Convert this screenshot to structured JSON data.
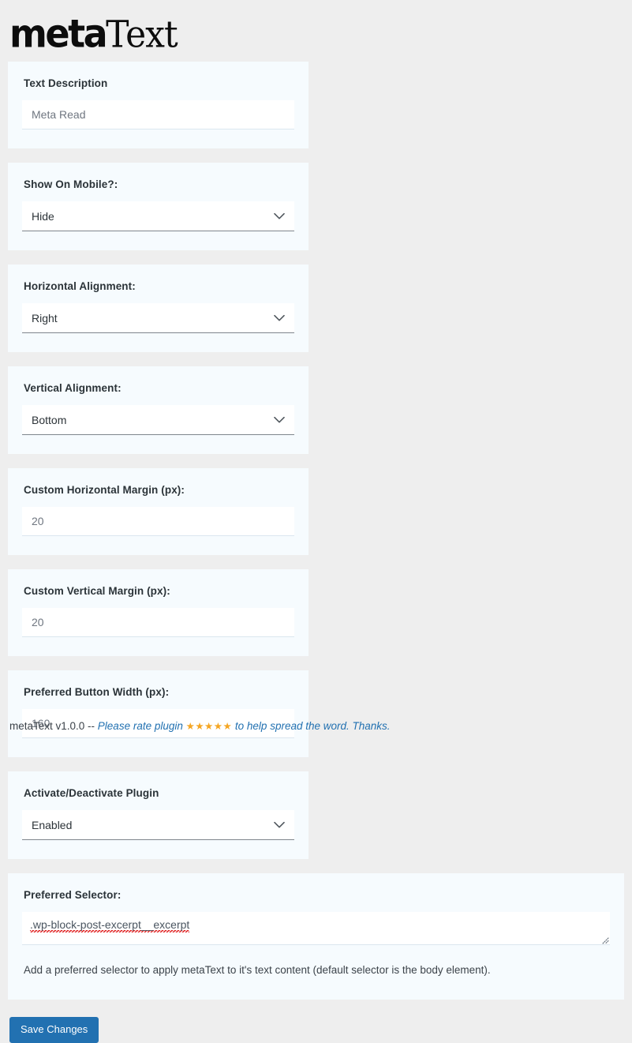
{
  "brand": {
    "logo_meta": "meta",
    "logo_text": "Text"
  },
  "fields": [
    {
      "label": "Text Description",
      "type": "text",
      "value": "Meta Read",
      "placeholder": "Meta Read",
      "name": "text-description"
    },
    {
      "label": "Show On Mobile?:",
      "type": "select",
      "value": "Hide",
      "icon": "chevron-down-icon",
      "name": "show-on-mobile"
    },
    {
      "label": "Horizontal Alignment:",
      "type": "select",
      "value": "Right",
      "icon": "chevron-down-icon",
      "name": "horizontal-alignment"
    },
    {
      "label": "Vertical Alignment:",
      "type": "select",
      "value": "Bottom",
      "icon": "chevron-down-icon",
      "name": "vertical-alignment"
    },
    {
      "label": "Custom Horizontal Margin (px):",
      "type": "text",
      "value": "20",
      "placeholder": "20",
      "name": "custom-horizontal-margin"
    },
    {
      "label": "Custom Vertical Margin (px):",
      "type": "text",
      "value": "20",
      "placeholder": "20",
      "name": "custom-vertical-margin"
    },
    {
      "label": "Preferred Button Width (px):",
      "type": "text",
      "value": "160",
      "placeholder": "160",
      "name": "preferred-button-width"
    },
    {
      "label": "Activate/Deactivate Plugin",
      "type": "select",
      "value": "Enabled",
      "icon": "chevron-down-icon",
      "name": "activate-deactivate-plugin"
    }
  ],
  "selector_card": {
    "label": "Preferred Selector:",
    "value": ".wp-block-post-excerpt__excerpt",
    "help": "Add a preferred selector to apply metaText to it's text content (default selector is the body element)."
  },
  "actions": {
    "save_label": "Save Changes"
  },
  "footer": {
    "version": "metaText v1.0.0 -- ",
    "rate_prefix": "Please rate plugin ",
    "stars": "★★★★★",
    "rate_suffix": " to help spread the word. Thanks."
  },
  "colors": {
    "page_background": "#eeeeee",
    "card_background": "#f6fbfe",
    "input_background": "#ffffff",
    "label_text": "#2b3338",
    "accent_blue": "#2271b1",
    "star_gold": "#f5a623",
    "spellcheck_red": "#e02020"
  }
}
